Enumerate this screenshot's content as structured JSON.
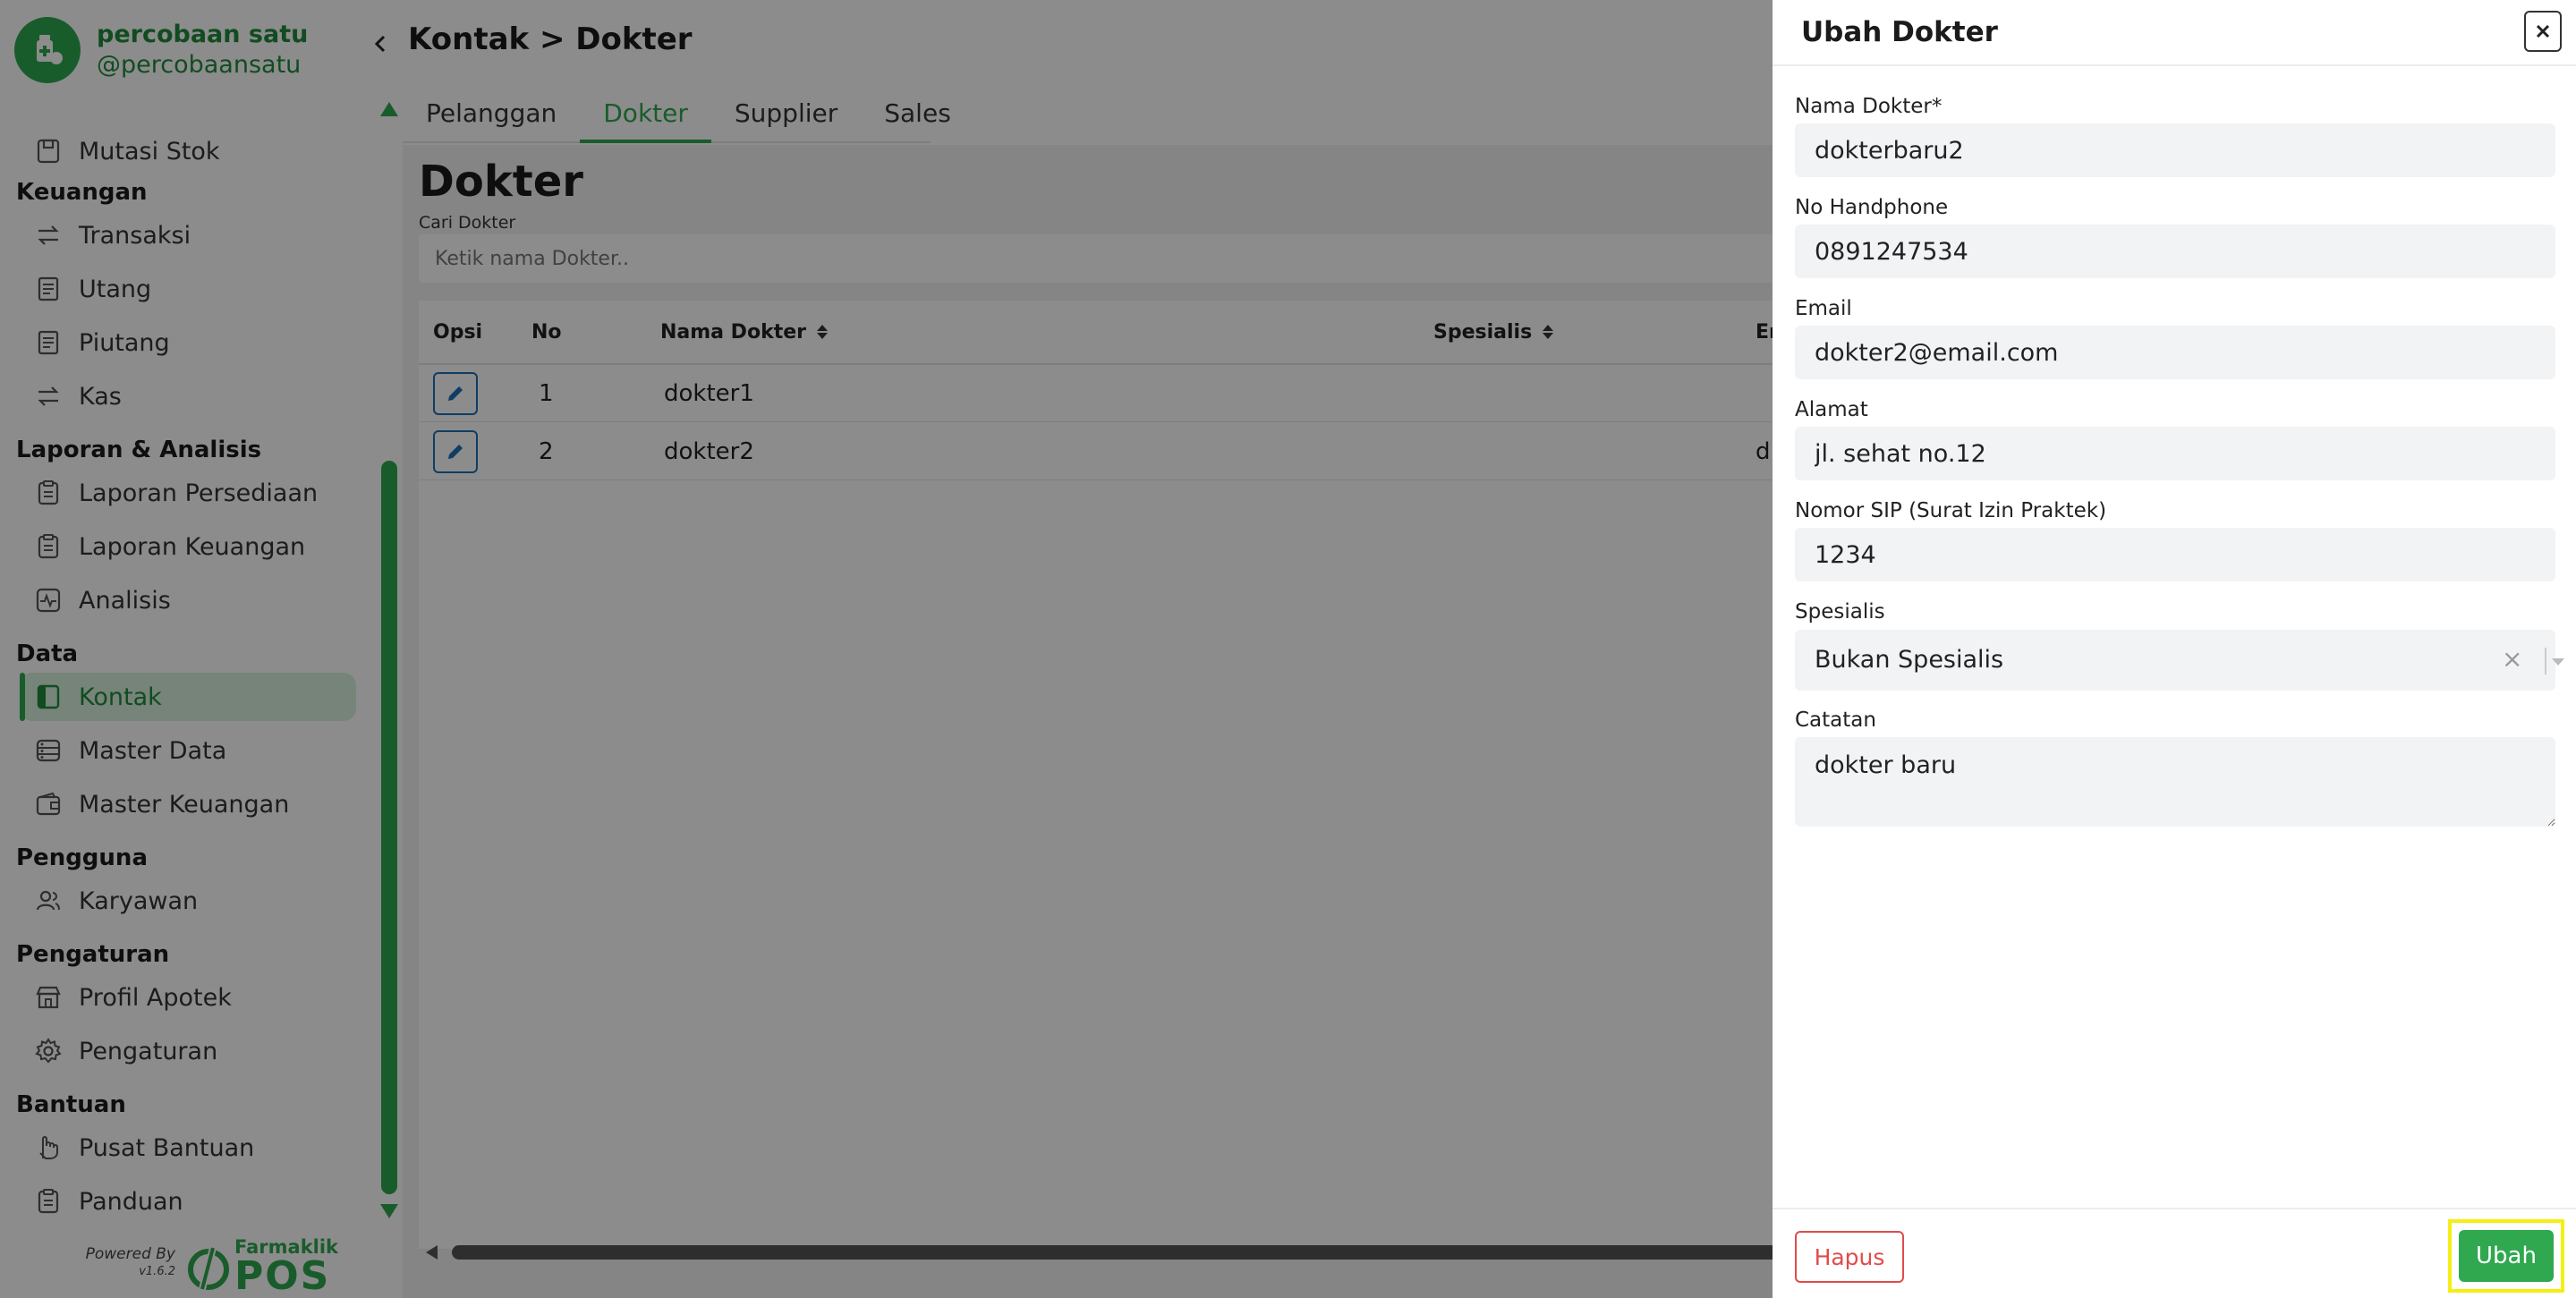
{
  "profile": {
    "name": "percobaan satu",
    "username": "@percobaansatu"
  },
  "sidebar": {
    "sections": [
      {
        "title": "Keuangan",
        "items": [
          {
            "label": "Transaksi",
            "icon": "exchange-icon"
          },
          {
            "label": "Utang",
            "icon": "document-icon"
          },
          {
            "label": "Piutang",
            "icon": "document-icon"
          },
          {
            "label": "Kas",
            "icon": "exchange-icon"
          }
        ]
      },
      {
        "title": "Laporan & Analisis",
        "items": [
          {
            "label": "Laporan Persediaan",
            "icon": "clipboard-icon"
          },
          {
            "label": "Laporan Keuangan",
            "icon": "clipboard-icon"
          },
          {
            "label": "Analisis",
            "icon": "activity-icon"
          }
        ]
      },
      {
        "title": "Data",
        "items": [
          {
            "label": "Kontak",
            "icon": "book-icon",
            "active": true
          },
          {
            "label": "Master Data",
            "icon": "database-icon"
          },
          {
            "label": "Master Keuangan",
            "icon": "wallet-icon"
          }
        ]
      },
      {
        "title": "Pengguna",
        "items": [
          {
            "label": "Karyawan",
            "icon": "users-icon"
          }
        ]
      },
      {
        "title": "Pengaturan",
        "items": [
          {
            "label": "Profil Apotek",
            "icon": "store-icon"
          },
          {
            "label": "Pengaturan",
            "icon": "gear-icon"
          }
        ]
      },
      {
        "title": "Bantuan",
        "items": [
          {
            "label": "Pusat Bantuan",
            "icon": "hand-icon"
          },
          {
            "label": "Panduan",
            "icon": "clipboard-icon"
          }
        ]
      }
    ],
    "top_item": {
      "label": "Mutasi Stok",
      "icon": "box-icon"
    },
    "powered_by": "Powered By",
    "version": "v1.6.2",
    "logo_top": "Farmaklik",
    "logo_bottom": "POS"
  },
  "main": {
    "breadcrumb": "Kontak > Dokter",
    "tabs": [
      "Pelanggan",
      "Dokter",
      "Supplier",
      "Sales"
    ],
    "active_tab": "Dokter",
    "title": "Dokter",
    "search_label": "Cari Dokter",
    "search_placeholder": "Ketik nama Dokter..",
    "table": {
      "headers": {
        "opsi": "Opsi",
        "no": "No",
        "nama": "Nama Dokter",
        "spesialis": "Spesialis",
        "email": "Em"
      },
      "rows": [
        {
          "no": "1",
          "nama": "dokter1",
          "email": ""
        },
        {
          "no": "2",
          "nama": "dokter2",
          "email": "d"
        }
      ]
    }
  },
  "drawer": {
    "title": "Ubah Dokter",
    "fields": {
      "nama": {
        "label": "Nama Dokter*",
        "value": "dokterbaru2"
      },
      "hp": {
        "label": "No Handphone",
        "value": "0891247534"
      },
      "email": {
        "label": "Email",
        "value": "dokter2@email.com"
      },
      "alamat": {
        "label": "Alamat",
        "value": "jl. sehat no.12"
      },
      "sip": {
        "label": "Nomor SIP (Surat Izin Praktek)",
        "value": "1234"
      },
      "spesialis": {
        "label": "Spesialis",
        "value": "Bukan Spesialis"
      },
      "catatan": {
        "label": "Catatan",
        "value": "dokter baru"
      }
    },
    "delete_label": "Hapus",
    "submit_label": "Ubah"
  },
  "colors": {
    "brand": "#2fa84f",
    "danger": "#e14b4b",
    "highlight": "#f3ef16",
    "edit": "#1d6fb8"
  }
}
